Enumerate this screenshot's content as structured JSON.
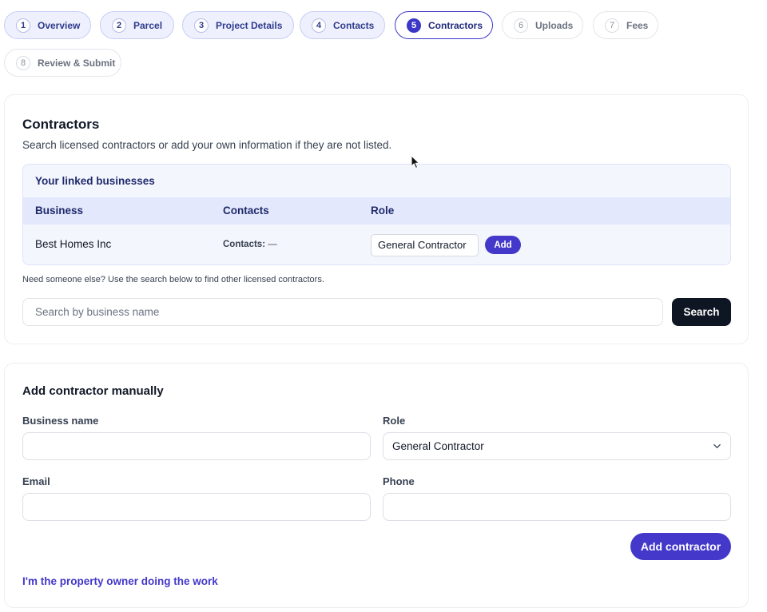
{
  "steps": [
    {
      "num": "1",
      "label": "Overview",
      "state": "done"
    },
    {
      "num": "2",
      "label": "Parcel",
      "state": "done"
    },
    {
      "num": "3",
      "label": "Project Details",
      "state": "done"
    },
    {
      "num": "4",
      "label": "Contacts",
      "state": "done"
    },
    {
      "num": "5",
      "label": "Contractors",
      "state": "active"
    },
    {
      "num": "6",
      "label": "Uploads",
      "state": "todo"
    },
    {
      "num": "7",
      "label": "Fees",
      "state": "todo"
    },
    {
      "num": "8",
      "label": "Review & Submit",
      "state": "todo"
    }
  ],
  "contractors": {
    "title": "Contractors",
    "subtitle": "Search licensed contractors or add your own information if they are not listed.",
    "linked": {
      "title": "Your linked businesses",
      "columns": [
        "Business",
        "Contacts",
        "Role"
      ],
      "rows": [
        {
          "business": "Best Homes Inc",
          "contacts_label": "Contacts:",
          "contacts_value": "—",
          "role": "General Contractor",
          "add_label": "Add"
        }
      ]
    },
    "hint": "Need someone else? Use the search below to find other licensed contractors.",
    "search": {
      "placeholder": "Search by business name",
      "button": "Search"
    }
  },
  "manual": {
    "title": "Add contractor manually",
    "business_name_label": "Business name",
    "business_name_value": "",
    "role_label": "Role",
    "role_value": "General Contractor",
    "email_label": "Email",
    "email_value": "",
    "phone_label": "Phone",
    "phone_value": "",
    "add_button": "Add contractor",
    "owner_link": "I'm the property owner doing the work"
  },
  "colors": {
    "accent": "#4338ca",
    "dark_button": "#0f1623",
    "linked_bg": "#f4f6fe"
  }
}
